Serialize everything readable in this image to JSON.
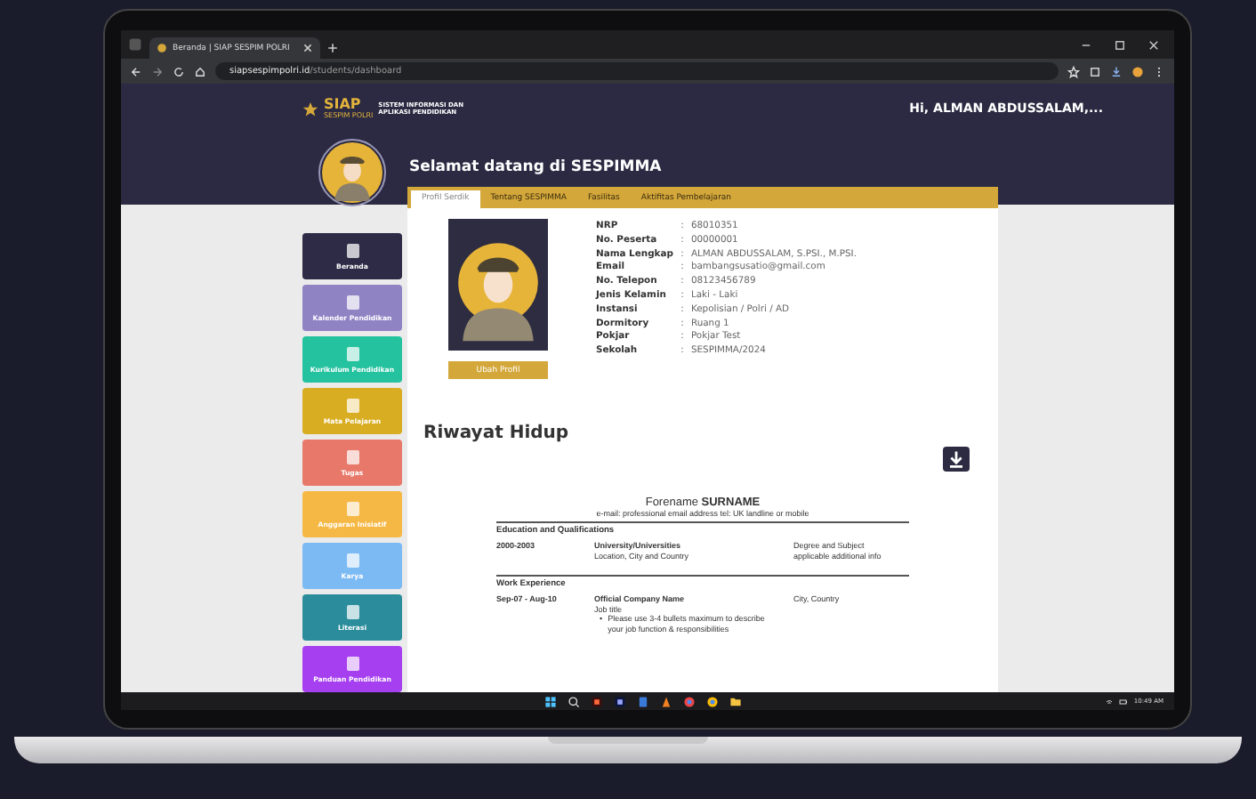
{
  "browser": {
    "tab_title": "Beranda | SIAP SESPIM POLRI",
    "url_host": "siapsespimpolri.id",
    "url_path": "/students/dashboard"
  },
  "header": {
    "logo_text": "SIAP",
    "logo_sub": "SESPIM POLRI",
    "logo_caption": "SISTEM INFORMASI DAN APLIKASI PENDIDIKAN",
    "greeting_user": "Hi, ALMAN ABDUSSALAM,..."
  },
  "welcome": "Selamat datang di SESPIMMA",
  "sidebar": {
    "items": [
      {
        "label": "Beranda",
        "color": "#2d2b45"
      },
      {
        "label": "Kalender Pendidikan",
        "color": "#8f83c4"
      },
      {
        "label": "Kurikulum Pendidikan",
        "color": "#25c2a0"
      },
      {
        "label": "Mata Pelajaran",
        "color": "#d9ad22"
      },
      {
        "label": "Tugas",
        "color": "#e8796a"
      },
      {
        "label": "Anggaran Inisiatif",
        "color": "#f6b845"
      },
      {
        "label": "Karya",
        "color": "#7cbaf4"
      },
      {
        "label": "Literasi",
        "color": "#2b8d9c"
      },
      {
        "label": "Panduan Pendidikan",
        "color": "#a63ff0"
      }
    ]
  },
  "tabs": [
    {
      "label": "Profil Serdik",
      "selected": true
    },
    {
      "label": "Tentang SESPIMMA",
      "selected": false
    },
    {
      "label": "Fasilitas",
      "selected": false
    },
    {
      "label": "Aktifitas Pembelajaran",
      "selected": false
    }
  ],
  "profile": {
    "edit_button": "Ubah Profil",
    "fields": [
      {
        "label": "NRP",
        "separator": ":",
        "value": "68010351"
      },
      {
        "label": "No. Peserta",
        "separator": ":",
        "value": "00000001"
      },
      {
        "label": "Nama Lengkap",
        "separator": ":",
        "value": "ALMAN ABDUSSALAM, S.PSI., M.PSI."
      },
      {
        "label": "Email",
        "separator": ":",
        "value": "bambangsusatio@gmail.com"
      },
      {
        "label": "No. Telepon",
        "separator": ":",
        "value": "08123456789"
      },
      {
        "label": "Jenis Kelamin",
        "separator": ":",
        "value": "Laki - Laki"
      },
      {
        "label": "Instansi",
        "separator": ":",
        "value": "Kepolisian / Polri / AD"
      },
      {
        "label": "Dormitory",
        "separator": ":",
        "value": "Ruang 1"
      },
      {
        "label": "Pokjar",
        "separator": ":",
        "value": "Pokjar Test"
      },
      {
        "label": "Sekolah",
        "separator": ":",
        "value": "SESPIMMA/2024"
      }
    ]
  },
  "cv": {
    "heading": "Riwayat Hidup",
    "name": "Forename **SURNAME**",
    "contact": "e-mail: professional email address tel: UK landline or mobile",
    "sections": [
      {
        "title": "Education and Qualifications",
        "entries": [
          {
            "date": "2000-2003",
            "lines": [
              "**University/Universities**",
              "Location, City and Country"
            ],
            "side": [
              "Degree and Subject",
              "applicable additional info"
            ]
          }
        ]
      },
      {
        "title": "Work Experience",
        "entries": [
          {
            "date": "Sep-07 - Aug-10",
            "lines": [
              "**Official Company Name**",
              "Job title"
            ],
            "bullets": [
              {
                "marker": "•",
                "text": "Please use 3-4 bullets maximum to describe your job function & responsibilities"
              }
            ],
            "side": [
              "City, Country"
            ]
          }
        ]
      }
    ]
  },
  "taskbar": {
    "time": "10:49 AM"
  }
}
